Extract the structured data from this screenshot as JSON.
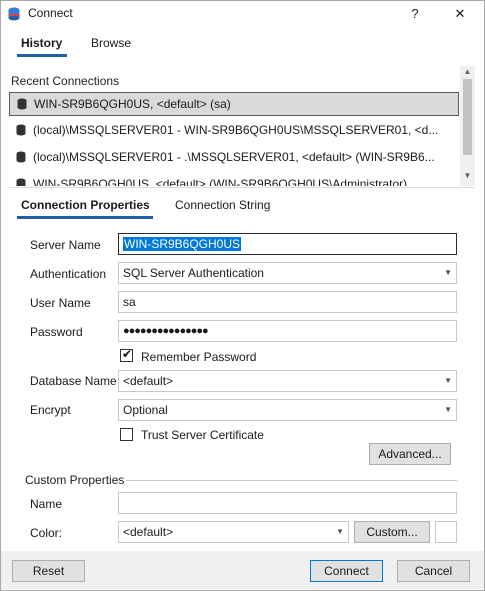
{
  "window": {
    "title": "Connect",
    "help": "?",
    "close": "✕"
  },
  "top_tabs": [
    {
      "label": "History"
    },
    {
      "label": "Browse"
    }
  ],
  "recent": {
    "label": "Recent Connections",
    "items": [
      {
        "text": "WIN-SR9B6QGH0US, <default> (sa)"
      },
      {
        "text": "(local)\\MSSQLSERVER01 - WIN-SR9B6QGH0US\\MSSQLSERVER01, <d..."
      },
      {
        "text": "(local)\\MSSQLSERVER01 - .\\MSSQLSERVER01, <default> (WIN-SR9B6..."
      },
      {
        "text": "WIN-SR9B6QGH0US, <default> (WIN-SR9B6QGH0US\\Administrator)"
      }
    ]
  },
  "prop_tabs": [
    {
      "label": "Connection Properties"
    },
    {
      "label": "Connection String"
    }
  ],
  "form": {
    "server_name_label": "Server Name",
    "server_name_value": "WIN-SR9B6QGH0US",
    "auth_label": "Authentication",
    "auth_value": "SQL Server Authentication",
    "user_label": "User Name",
    "user_value": "sa",
    "password_label": "Password",
    "password_value": "●●●●●●●●●●●●●●●",
    "remember_label": "Remember Password",
    "remember_checked": true,
    "db_label": "Database Name",
    "db_value": "<default>",
    "encrypt_label": "Encrypt",
    "encrypt_value": "Optional",
    "trust_label": "Trust Server Certificate",
    "trust_checked": false,
    "advanced_label": "Advanced..."
  },
  "custom": {
    "header": "Custom Properties",
    "name_label": "Name",
    "name_value": "",
    "color_label": "Color:",
    "color_value": "<default>",
    "custom_button": "Custom..."
  },
  "footer": {
    "reset": "Reset",
    "connect": "Connect",
    "cancel": "Cancel"
  },
  "colors": {
    "accent": "#1f5fa8",
    "selection": "#0078d7",
    "footer_bg": "#f0f0f0"
  }
}
